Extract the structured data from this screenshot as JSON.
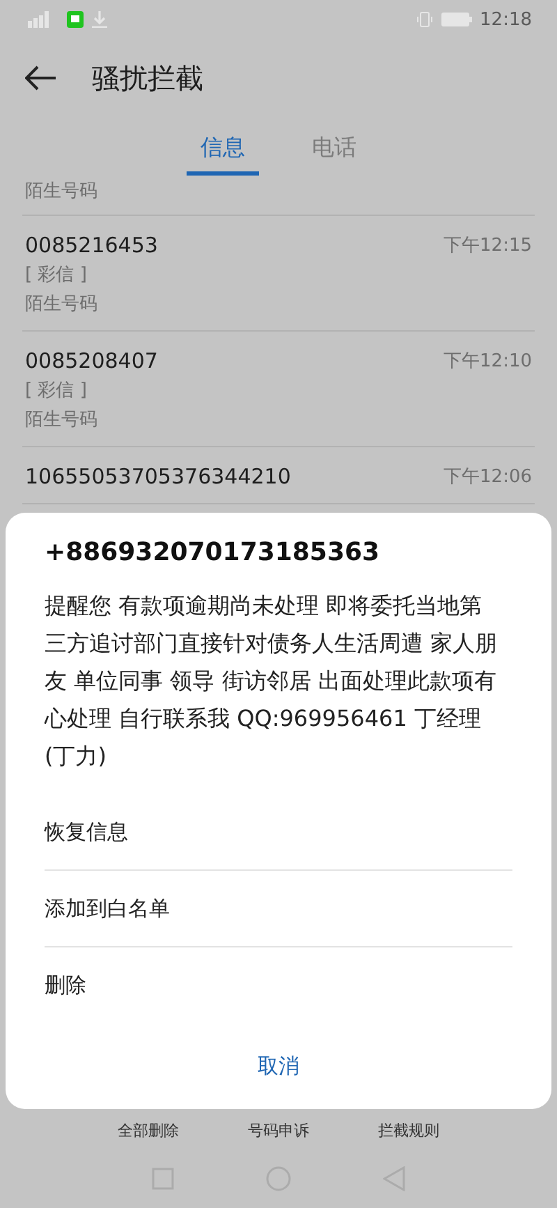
{
  "status_bar": {
    "time": "12:18"
  },
  "header": {
    "title": "骚扰拦截"
  },
  "tabs": [
    {
      "label": "信息",
      "selected": true
    },
    {
      "label": "电话",
      "selected": false
    }
  ],
  "messages": [
    {
      "sender": "陌生号码",
      "partial": true
    },
    {
      "number": "0085216453",
      "time": "下午12:15",
      "type": "[ 彩信 ]",
      "sender": "陌生号码",
      "partial": false
    },
    {
      "number": "0085208407",
      "time": "下午12:10",
      "type": "[ 彩信 ]",
      "sender": "陌生号码",
      "partial": false
    },
    {
      "number": "10655053705376344210",
      "time": "下午12:06",
      "partial": false
    }
  ],
  "toolbar": [
    "全部删除",
    "号码申诉",
    "拦截规则"
  ],
  "dialog": {
    "number": "+886932070173185363",
    "body": "提醒您 有款项逾期尚未处理 即将委托当地第三方追讨部门直接针对债务人生活周遭 家人朋友 单位同事 领导 街访邻居 出面处理此款项有心处理 自行联系我 QQ:969956461 丁经理(丁力)",
    "options": [
      "恢复信息",
      "添加到白名单",
      "删除"
    ],
    "cancel": "取消"
  }
}
